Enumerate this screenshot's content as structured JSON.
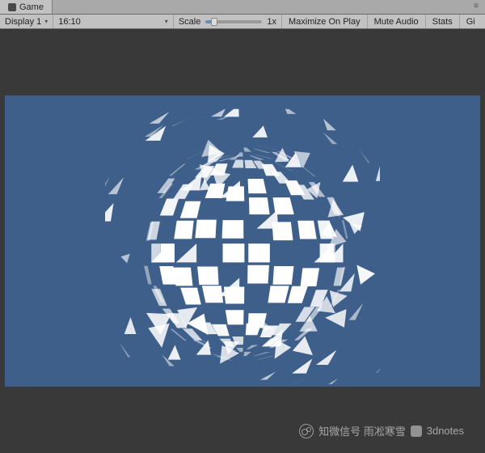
{
  "tab": {
    "label": "Game"
  },
  "toolbar": {
    "display": {
      "label": "Display 1"
    },
    "aspect": {
      "label": "16:10"
    },
    "scale": {
      "label": "Scale",
      "value": "1x"
    },
    "maximize": "Maximize On Play",
    "muteAudio": "Mute Audio",
    "stats": "Stats",
    "gizmos": "Gi"
  },
  "watermark": {
    "text1": "知微信号 雨凇寒雪",
    "text2": "3dnotes"
  },
  "render": {
    "bgColor": "#3e5f8a",
    "sphereColor": "#ffffff"
  }
}
